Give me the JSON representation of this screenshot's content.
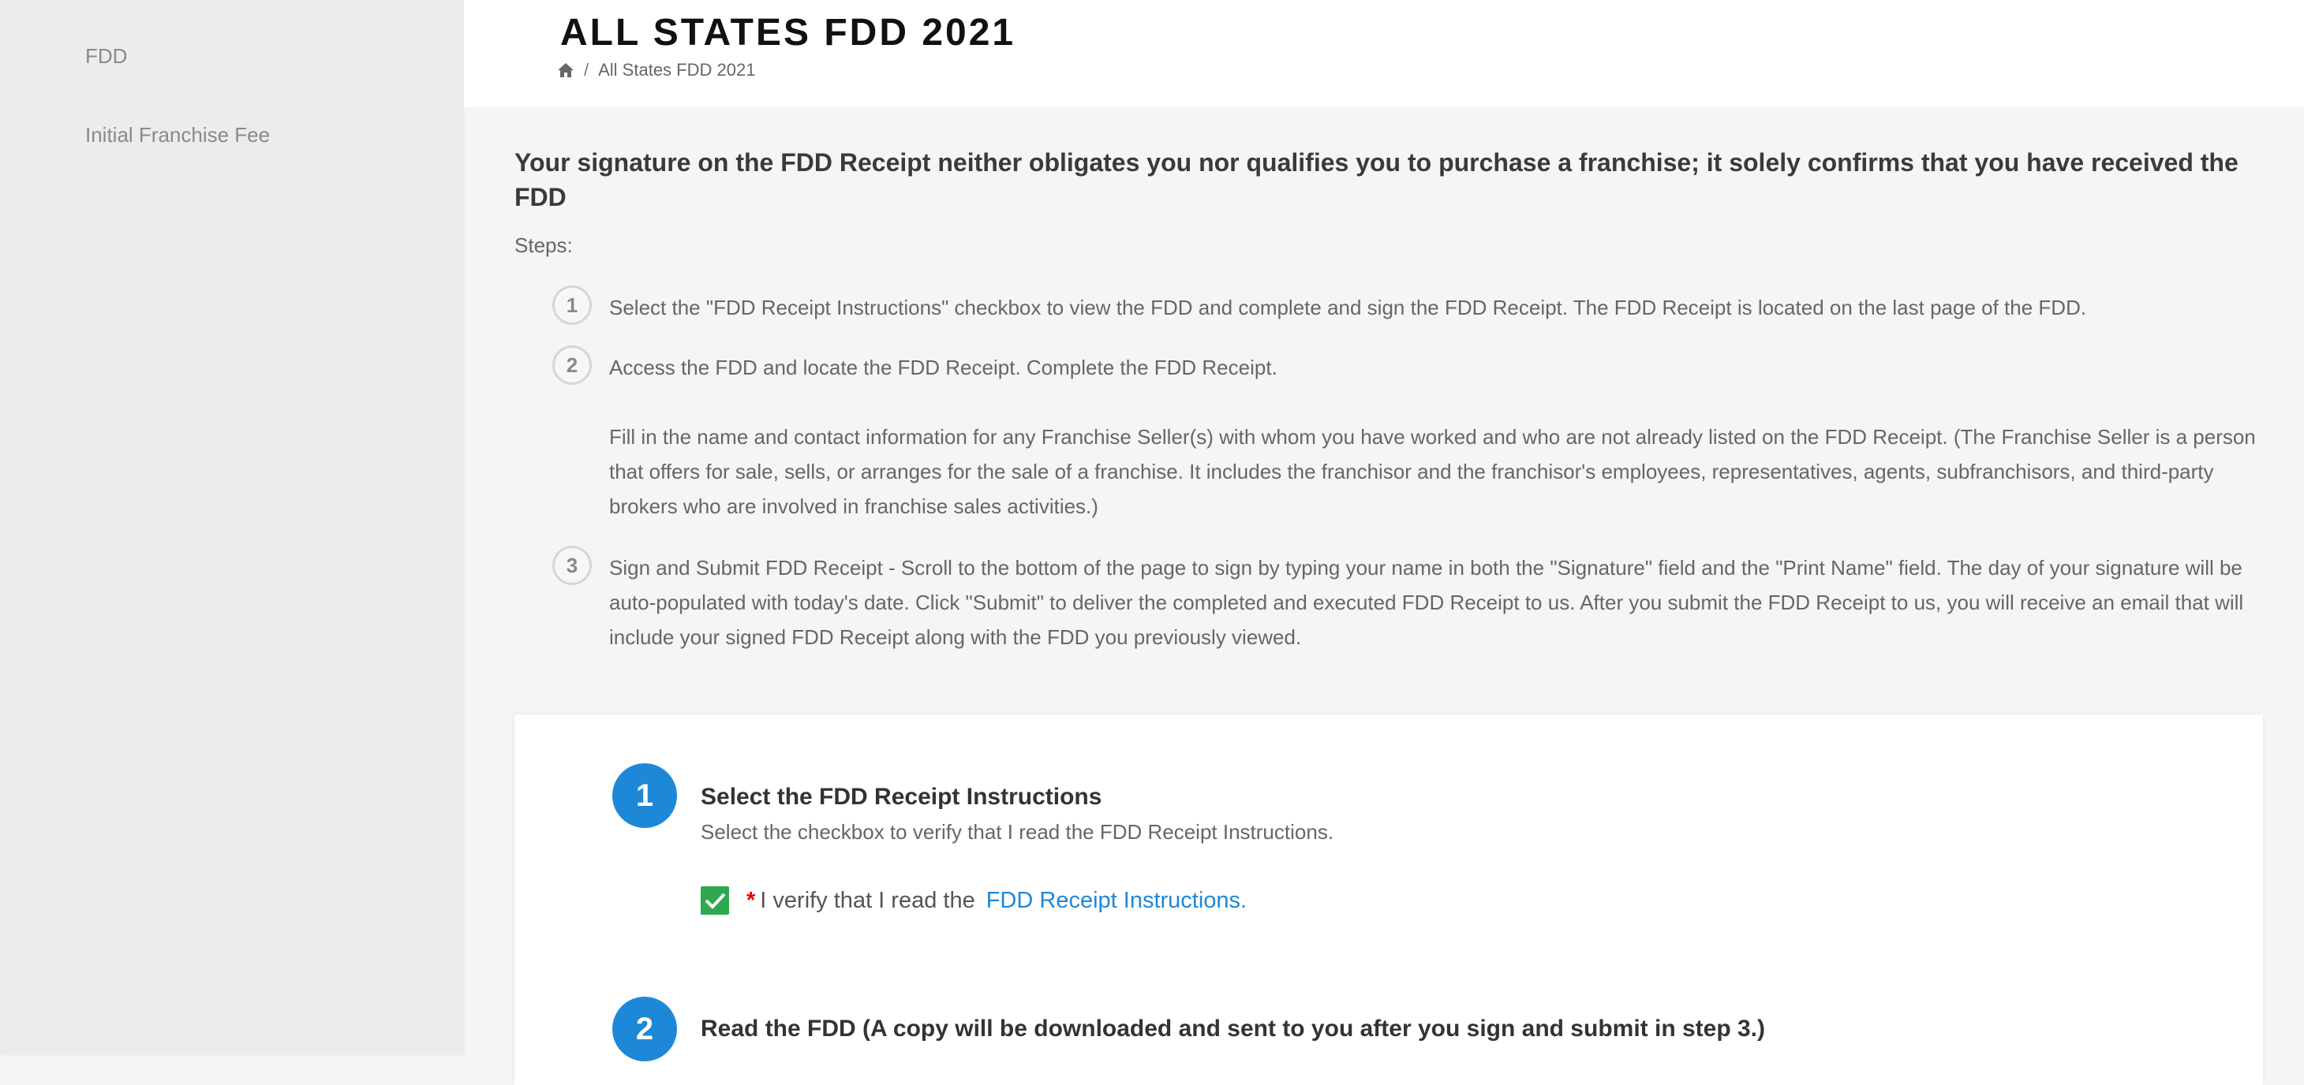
{
  "sidebar": {
    "items": [
      {
        "label": "FDD"
      },
      {
        "label": "Initial Franchise Fee"
      }
    ]
  },
  "header": {
    "title": "ALL STATES FDD 2021",
    "breadcrumb": {
      "separator": "/",
      "current": "All States FDD 2021"
    }
  },
  "main": {
    "notice": "Your signature on the FDD Receipt neither obligates you nor qualifies you to purchase a franchise; it solely confirms that you have received the FDD",
    "steps_label": "Steps:",
    "steps": [
      {
        "num": "1",
        "text": "Select the \"FDD Receipt Instructions\" checkbox to view the FDD and complete and sign the FDD Receipt. The FDD Receipt is located on the last page of the FDD."
      },
      {
        "num": "2",
        "text": "Access the FDD and locate the FDD Receipt. Complete the FDD Receipt."
      },
      {
        "num": "3",
        "text": "Sign and Submit FDD Receipt - Scroll to the bottom of the page to sign by typing your name in both the \"Signature\" field and the \"Print Name\" field. The day of your signature will be auto-populated with today's date. Click \"Submit\" to deliver the completed and executed FDD Receipt to us. After you submit the FDD Receipt to us, you will receive an email that will include your signed FDD Receipt along with the FDD you previously viewed."
      }
    ],
    "step2_extra": "Fill in the name and contact information for any Franchise Seller(s) with whom you have worked and who are not already listed on the FDD Receipt. (The Franchise Seller is a person that offers for sale, sells, or arranges for the sale of a franchise. It includes the franchisor and the franchisor's employees, representatives, agents, subfranchisors, and third-party brokers who are involved in franchise sales activities.)"
  },
  "card": {
    "section1": {
      "num": "1",
      "title": "Select the FDD Receipt Instructions",
      "desc": "Select the checkbox to verify that I read the FDD Receipt Instructions.",
      "checked": true,
      "required_mark": "*",
      "verify_text": "I verify that I read the",
      "link_text": "FDD Receipt Instructions."
    },
    "section2": {
      "num": "2",
      "title": "Read the FDD (A copy will be downloaded and sent to you after you sign and submit in step 3.)"
    }
  },
  "colors": {
    "accent": "#1e88d8",
    "check": "#2fa84f",
    "required": "#e00000"
  }
}
